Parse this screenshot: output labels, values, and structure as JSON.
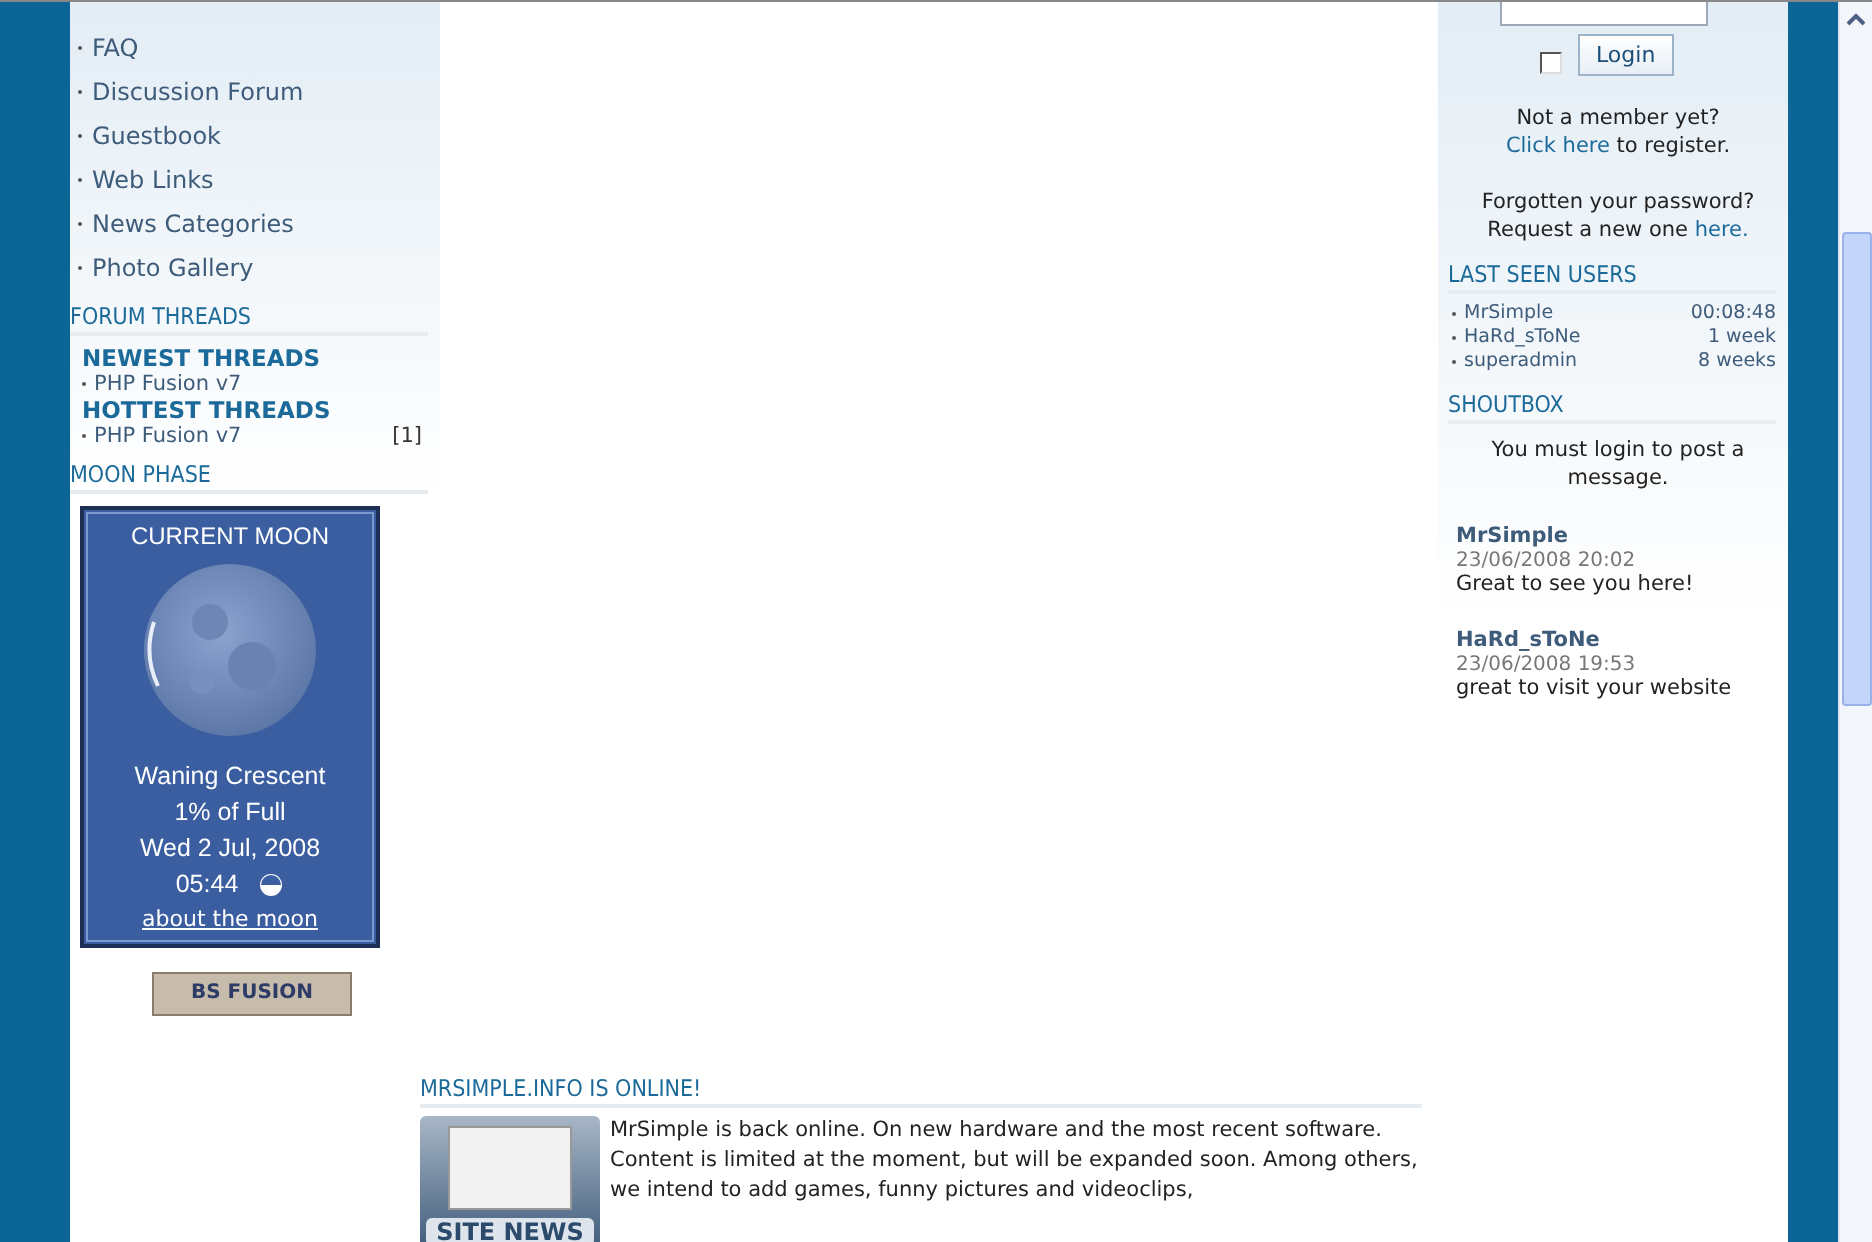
{
  "nav_links": [
    {
      "label": "FAQ"
    },
    {
      "label": "Discussion Forum"
    },
    {
      "label": "Guestbook"
    },
    {
      "label": "Web Links"
    },
    {
      "label": "News Categories"
    },
    {
      "label": "Photo Gallery"
    }
  ],
  "forum_threads": {
    "title": "FORUM THREADS",
    "groups": [
      {
        "heading": "NEWEST THREADS",
        "items": [
          {
            "label": "PHP Fusion v7"
          }
        ]
      },
      {
        "heading": "HOTTEST THREADS",
        "items": [
          {
            "label": "PHP Fusion v7",
            "count": "[1]"
          }
        ]
      }
    ]
  },
  "moon_phase": {
    "title": "MOON PHASE",
    "widget_title": "CURRENT MOON",
    "phase": "Waning Crescent",
    "illumination": "1% of Full",
    "date": "Wed 2 Jul, 2008",
    "time": "05:44",
    "link": "about the moon"
  },
  "banner": {
    "brand": "BS FUSION"
  },
  "login": {
    "remember": false,
    "button": "Login",
    "register_before": "Not a member yet?",
    "register_link": "Click here",
    "register_after": "to register.",
    "forgot_before": "Forgotten your password?",
    "forgot_text": "Request a new one",
    "forgot_link": "here."
  },
  "last_seen": {
    "title": "LAST SEEN USERS",
    "users": [
      {
        "name": "MrSimple",
        "time": "00:08:48"
      },
      {
        "name": "HaRd_sToNe",
        "time": "1 week"
      },
      {
        "name": "superadmin",
        "time": "8 weeks"
      }
    ]
  },
  "shoutbox": {
    "title": "SHOUTBOX",
    "notice": "You must login to post a message.",
    "posts": [
      {
        "author": "MrSimple",
        "date": "23/06/2008 20:02",
        "message": "Great to see you here!"
      },
      {
        "author": "HaRd_sToNe",
        "date": "23/06/2008 19:53",
        "message": "great to visit your website"
      }
    ]
  },
  "news": {
    "title": "MRSIMPLE.INFO IS ONLINE!",
    "image_label": "SITE NEWS",
    "paragraphs": [
      "MrSimple is back online. On new hardware and the most recent software.",
      "Content is limited at the moment, but will be expanded soon. Among others, we intend to add games, funny pictures and videoclips,"
    ]
  }
}
